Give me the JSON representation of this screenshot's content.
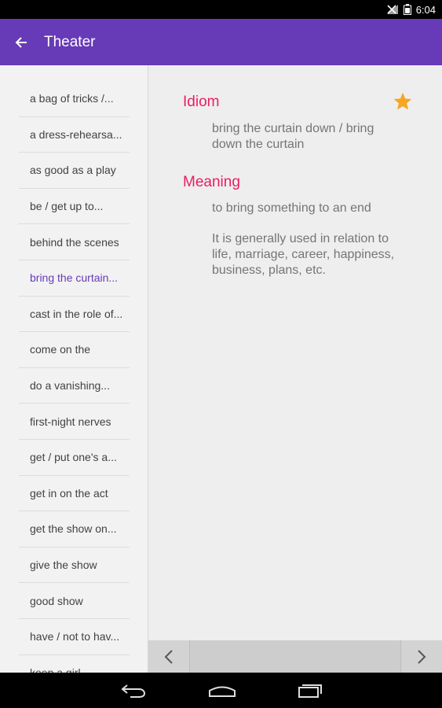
{
  "status_bar": {
    "time": "6:04"
  },
  "app_bar": {
    "title": "Theater"
  },
  "sidebar": {
    "items": [
      {
        "label": "a bag of tricks /..."
      },
      {
        "label": "a dress-rehearsa..."
      },
      {
        "label": "as good as a play"
      },
      {
        "label": "be / get up to..."
      },
      {
        "label": "behind the scenes"
      },
      {
        "label": "bring the curtain...",
        "active": true
      },
      {
        "label": "cast in the role of..."
      },
      {
        "label": "come on the"
      },
      {
        "label": "do a vanishing..."
      },
      {
        "label": "first-night nerves"
      },
      {
        "label": "get / put one's a..."
      },
      {
        "label": "get in on the act"
      },
      {
        "label": "get the show on..."
      },
      {
        "label": "give the show"
      },
      {
        "label": "good show"
      },
      {
        "label": "have / not to hav..."
      },
      {
        "label": "keep a girl..."
      }
    ]
  },
  "detail": {
    "idiom_heading": "Idiom",
    "idiom_text": "bring the curtain down / bring down the curtain",
    "meaning_heading": "Meaning",
    "meaning_text": "to bring something to an end",
    "usage_text": "It is generally used in relation to life, marriage, career, happiness, business, plans, etc.",
    "favorite": true,
    "favorite_icon": "star-icon",
    "favorite_color": "#f5a623"
  },
  "colors": {
    "app_bar": "#673ab7",
    "accent": "#e91e63",
    "active_item": "#673ab7"
  }
}
